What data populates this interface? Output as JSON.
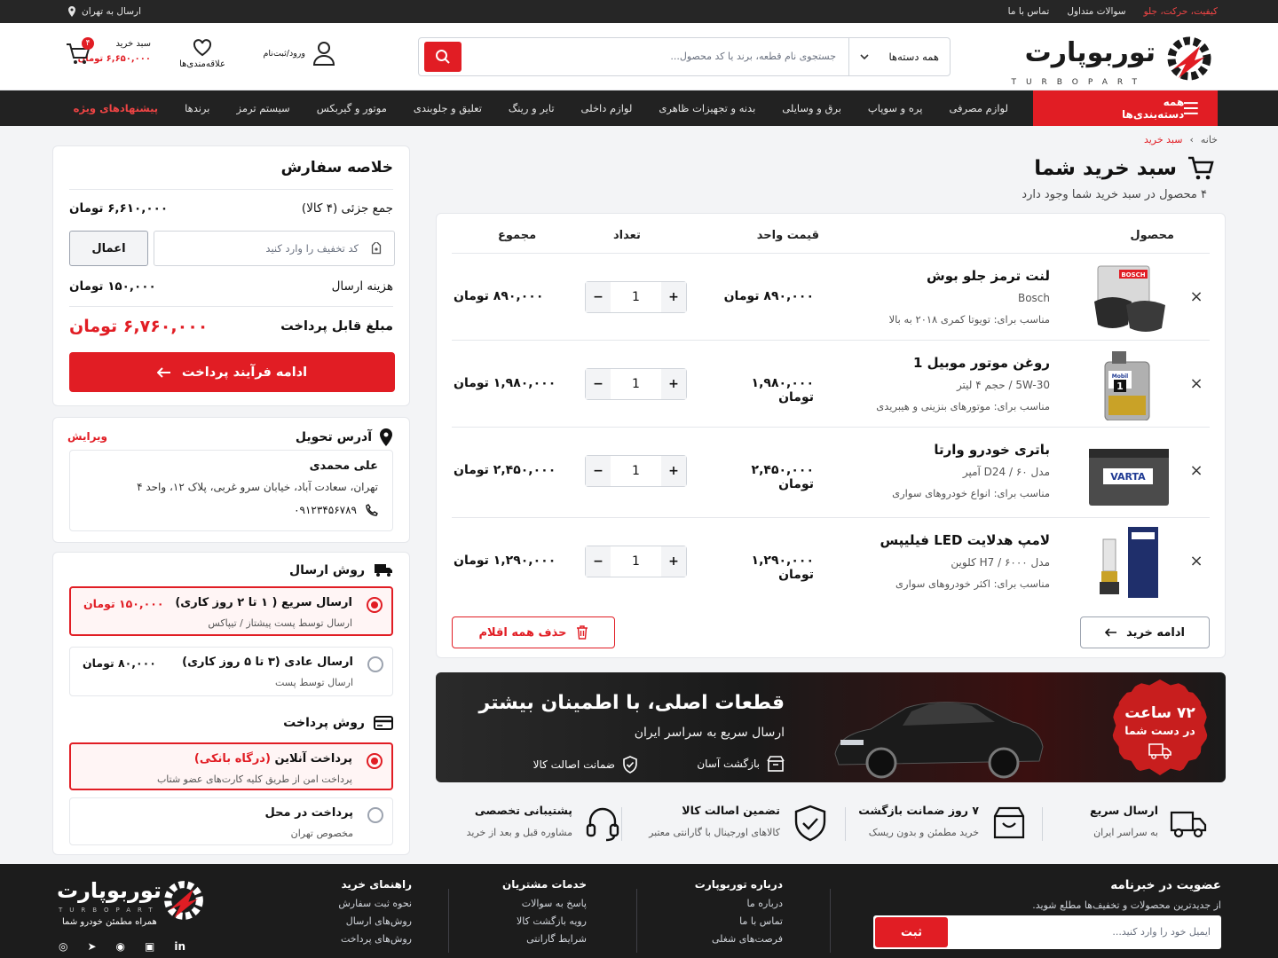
{
  "topbar": {
    "right_links": [
      {
        "label": "کیفیت، حرکت، جلو",
        "red": true
      },
      {
        "label": "سوالات متداول"
      },
      {
        "label": "تماس با ما"
      }
    ],
    "location": "ارسال به تهران"
  },
  "header": {
    "brand": "توربوپارت",
    "brand_sub": "TURBOPART",
    "search": {
      "category": "همه دسته‌ها",
      "placeholder": "جستجوی نام قطعه، برند یا کد محصول..."
    },
    "login": "ورود/ثبت‌نام",
    "favorites": "علاقه‌مندی‌ها",
    "cart_label": "سبد خرید",
    "cart_total": "۶,۶۵۰,۰۰۰ تومان",
    "cart_count": "۴"
  },
  "nav": {
    "all_categories": "همه دسته‌بندی‌ها",
    "items": [
      "لوازم مصرفی",
      "پره و سوپاپ",
      "برق و وسایلی",
      "بدنه و تجهیزات ظاهری",
      "لوازم داخلی",
      "تایر و رینگ",
      "تعلیق و جلوبندی",
      "موتور و گیربکس",
      "سیستم ترمز",
      "برندها"
    ],
    "special": "پیشنهادهای ویژه"
  },
  "breadcrumb": {
    "home": "خانه",
    "current": "سبد خرید"
  },
  "page": {
    "title": "سبد خرید شما",
    "subtitle": "۴ محصول در سبد خرید شما وجود دارد"
  },
  "cart": {
    "headers": {
      "product": "محصول",
      "unit_price": "قیمت واحد",
      "qty": "تعداد",
      "total": "مجموع"
    },
    "items": [
      {
        "name": "لنت ترمز جلو بوش",
        "spec": "Bosch",
        "fit": "مناسب برای: تویوتا کمری ۲۰۱۸ به بالا",
        "unit": "۸۹۰,۰۰۰ تومان",
        "qty": "1",
        "total": "۸۹۰,۰۰۰ تومان"
      },
      {
        "name": "روغن موتور موبیل 1",
        "spec": "5W-30 / حجم ۴ لیتر",
        "fit": "مناسب برای: موتورهای بنزینی و هیبریدی",
        "unit": "۱,۹۸۰,۰۰۰ تومان",
        "qty": "1",
        "total": "۱,۹۸۰,۰۰۰ تومان"
      },
      {
        "name": "باتری خودرو وارتا",
        "spec": "مدل D24 / ۶۰ آمپر",
        "fit": "مناسب برای: انواع خودروهای سواری",
        "unit": "۲,۴۵۰,۰۰۰ تومان",
        "qty": "1",
        "total": "۲,۴۵۰,۰۰۰ تومان"
      },
      {
        "name": "لامپ هدلایت LED فیلیپس",
        "spec": "مدل H7 / ۶۰۰۰ کلوین",
        "fit": "مناسب برای: اکثر خودروهای سواری",
        "unit": "۱,۲۹۰,۰۰۰ تومان",
        "qty": "1",
        "total": "۱,۲۹۰,۰۰۰ تومان"
      }
    ],
    "continue": "ادامه خرید",
    "clear": "حذف همه اقلام"
  },
  "banner": {
    "title": "قطعات اصلی، با اطمینان بیشتر",
    "subtitle": "ارسال سریع به سراسر ایران",
    "feature1": "بازگشت آسان",
    "feature2": "ضمانت اصالت کالا",
    "badge_big": "۷۲ ساعت",
    "badge_small": "در دست شما"
  },
  "features": [
    {
      "title": "ارسال سریع",
      "desc": "به سراسر ایران",
      "icon": "truck-icon"
    },
    {
      "title": "۷ روز ضمانت بازگشت",
      "desc": "خرید مطمئن و بدون ریسک",
      "icon": "box-icon"
    },
    {
      "title": "تضمین اصالت کالا",
      "desc": "کالاهای اورجینال با گارانتی معتبر",
      "icon": "shield-icon"
    },
    {
      "title": "پشتیبانی تخصصی",
      "desc": "مشاوره قبل و بعد از خرید",
      "icon": "headset-icon"
    }
  ],
  "summary": {
    "title": "خلاصه سفارش",
    "subtotal_label": "جمع جزئی (۴ کالا)",
    "subtotal": "۶,۶۱۰,۰۰۰ تومان",
    "coupon_placeholder": "کد تخفیف را وارد کنید",
    "apply": "اعمال",
    "shipping_label": "هزینه ارسال",
    "shipping": "۱۵۰,۰۰۰ تومان",
    "payable_label": "مبلغ قابل پرداخت",
    "payable": "۶,۷۶۰,۰۰۰ تومان",
    "checkout": "ادامه فرآیند پرداخت"
  },
  "address": {
    "title": "آدرس تحویل",
    "edit": "ویرایش",
    "name": "علی محمدی",
    "address": "تهران، سعادت آباد، خیابان سرو غربی، پلاک ۱۲، واحد ۴",
    "phone": "۰۹۱۲۳۴۵۶۷۸۹"
  },
  "shipping": {
    "title": "روش ارسال",
    "options": [
      {
        "title": "ارسال سریع ( ۱ تا ۲ روز کاری)",
        "desc": "ارسال توسط پست پیشتاز / تیپاکس",
        "price": "۱۵۰,۰۰۰ تومان",
        "selected": true
      },
      {
        "title": "ارسال عادی (۳ تا ۵ روز کاری)",
        "desc": "ارسال توسط پست",
        "price": "۸۰,۰۰۰ تومان",
        "selected": false
      }
    ]
  },
  "payment": {
    "title": "روش پرداخت",
    "options": [
      {
        "title": "پرداخت آنلاین",
        "title_red": "(درگاه بانکی)",
        "desc": "پرداخت امن از طریق کلیه کارت‌های عضو شتاب",
        "selected": true
      },
      {
        "title": "پرداخت در محل",
        "desc": "مخصوص تهران",
        "selected": false
      }
    ]
  },
  "footer": {
    "newsletter_title": "عضویت در خبرنامه",
    "newsletter_desc": "از جدیدترین محصولات و تخفیف‌ها مطلع شوید.",
    "email_placeholder": "ایمیل خود را وارد کنید...",
    "submit": "ثبت",
    "col1": {
      "title": "درباره توربوپارت",
      "links": [
        "درباره ما",
        "تماس با ما",
        "فرصت‌های شغلی"
      ]
    },
    "col2": {
      "title": "خدمات مشتریان",
      "links": [
        "پاسخ به سوالات",
        "رویه بازگشت کالا",
        "شرایط گارانتی"
      ]
    },
    "col3": {
      "title": "راهنمای خرید",
      "links": [
        "نحوه ثبت سفارش",
        "روش‌های ارسال",
        "روش‌های پرداخت"
      ]
    },
    "brand": "توربوپارت",
    "brand_sub": "TURBOPART",
    "tagline": "همراه مطمئن خودرو شما",
    "social": [
      "in",
      "▣",
      "◉",
      "➤",
      "◎"
    ]
  }
}
